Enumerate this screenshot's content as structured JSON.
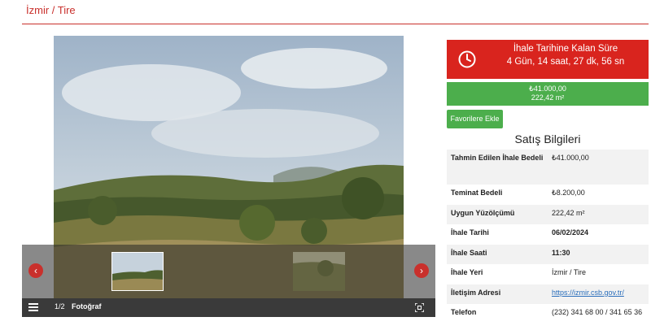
{
  "header": {
    "location_title": "İzmir / Tire"
  },
  "gallery": {
    "counter": "1/2",
    "label": "Fotoğraf",
    "prev_symbol": "‹",
    "next_symbol": "›"
  },
  "countdown": {
    "title": "İhale Tarihine Kalan Süre",
    "value": "4 Gün, 14 saat, 27 dk, 56 sn",
    "color": "#d9241e"
  },
  "price": {
    "amount": "₺41.000,00",
    "area": "222,42 m²",
    "color": "#4cae4c"
  },
  "favorites_button": {
    "label": "Favorilere Ekle"
  },
  "sale_info": {
    "title": "Satış Bilgileri",
    "rows": [
      {
        "label": "Tahmin Edilen İhale Bedeli",
        "value": "₺41.000,00"
      },
      {
        "label": "Teminat Bedeli",
        "value": "₺8.200,00"
      },
      {
        "label": "Uygun Yüzölçümü",
        "value": "222,42 m²"
      },
      {
        "label": "İhale Tarihi",
        "value": "06/02/2024"
      },
      {
        "label": "İhale Saati",
        "value": "11:30"
      },
      {
        "label": "İhale Yeri",
        "value": "İzmir / Tire"
      },
      {
        "label": "İletişim Adresi",
        "value": "https://izmir.csb.gov.tr/"
      },
      {
        "label": "Telefon",
        "value": "(232) 341 68 00 / 341 65 36"
      }
    ]
  }
}
